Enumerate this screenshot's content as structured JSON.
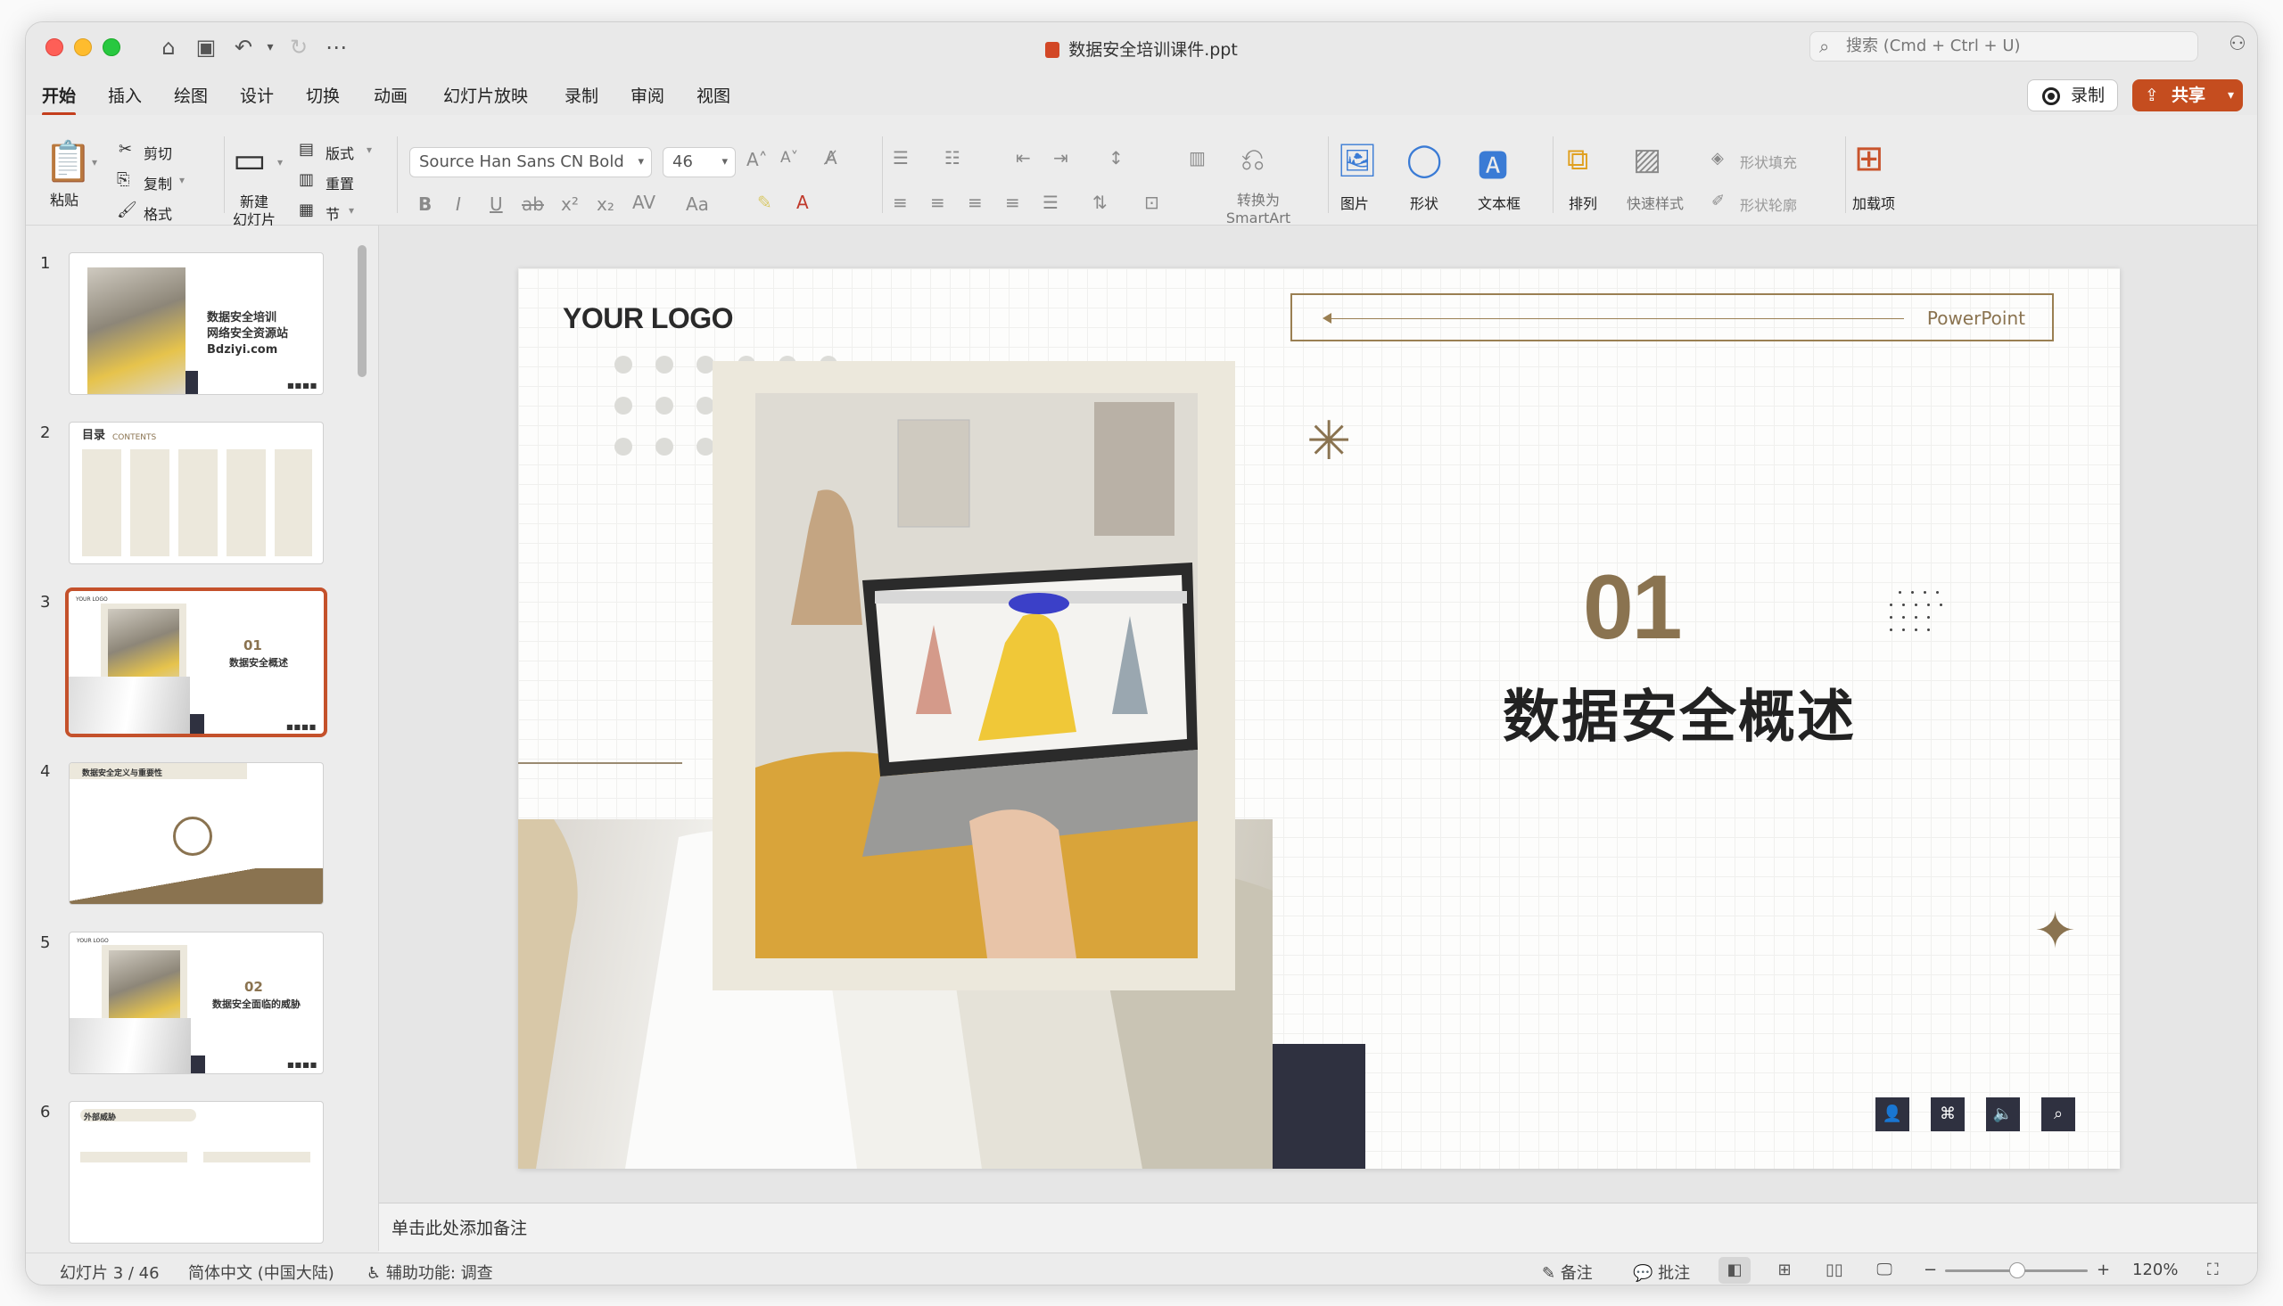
{
  "window": {
    "doc_title": "数据安全培训课件.ppt",
    "search_placeholder": "搜索 (Cmd + Ctrl + U)"
  },
  "tabs": [
    "开始",
    "插入",
    "绘图",
    "设计",
    "切换",
    "动画",
    "幻灯片放映",
    "录制",
    "审阅",
    "视图"
  ],
  "actions": {
    "record": "录制",
    "share": "共享"
  },
  "ribbon": {
    "paste": "粘贴",
    "cut": "剪切",
    "copy": "复制",
    "format": "格式",
    "new_slide_line1": "新建",
    "new_slide_line2": "幻灯片",
    "layout": "版式",
    "reset": "重置",
    "section": "节",
    "font_name": "Source Han Sans CN Bold",
    "font_size": "46",
    "convert_line1": "转换为",
    "convert_line2": "SmartArt",
    "picture": "图片",
    "shape": "形状",
    "textbox": "文本框",
    "arrange": "排列",
    "quick_styles": "快速样式",
    "shape_fill": "形状填充",
    "shape_outline": "形状轮廓",
    "addins": "加载项"
  },
  "thumbnails": [
    {
      "num": "1",
      "line1": "数据安全培训",
      "line2": "网络安全资源站",
      "line3": "Bdziyi.com"
    },
    {
      "num": "2",
      "title": "目录",
      "subtitle": "CONTENTS"
    },
    {
      "num": "3",
      "logo": "YOUR LOGO",
      "number": "01",
      "title": "数据安全概述"
    },
    {
      "num": "4",
      "title": "数据安全定义与重要性"
    },
    {
      "num": "5",
      "logo": "YOUR LOGO",
      "number": "02",
      "title": "数据安全面临的威胁"
    },
    {
      "num": "6",
      "title": "外部威胁"
    }
  ],
  "slide": {
    "logo": "YOUR LOGO",
    "powerpoint_label": "PowerPoint",
    "number": "01",
    "title": "数据安全概述"
  },
  "notes_placeholder": "单击此处添加备注",
  "status": {
    "slide_counter": "幻灯片 3 / 46",
    "language": "简体中文 (中国大陆)",
    "accessibility": "辅助功能: 调查",
    "notes": "备注",
    "comments": "批注",
    "zoom": "120%"
  },
  "colors": {
    "accent": "#c54d1f",
    "brand_gold": "#8a7350",
    "dark_block": "#2f3140"
  }
}
